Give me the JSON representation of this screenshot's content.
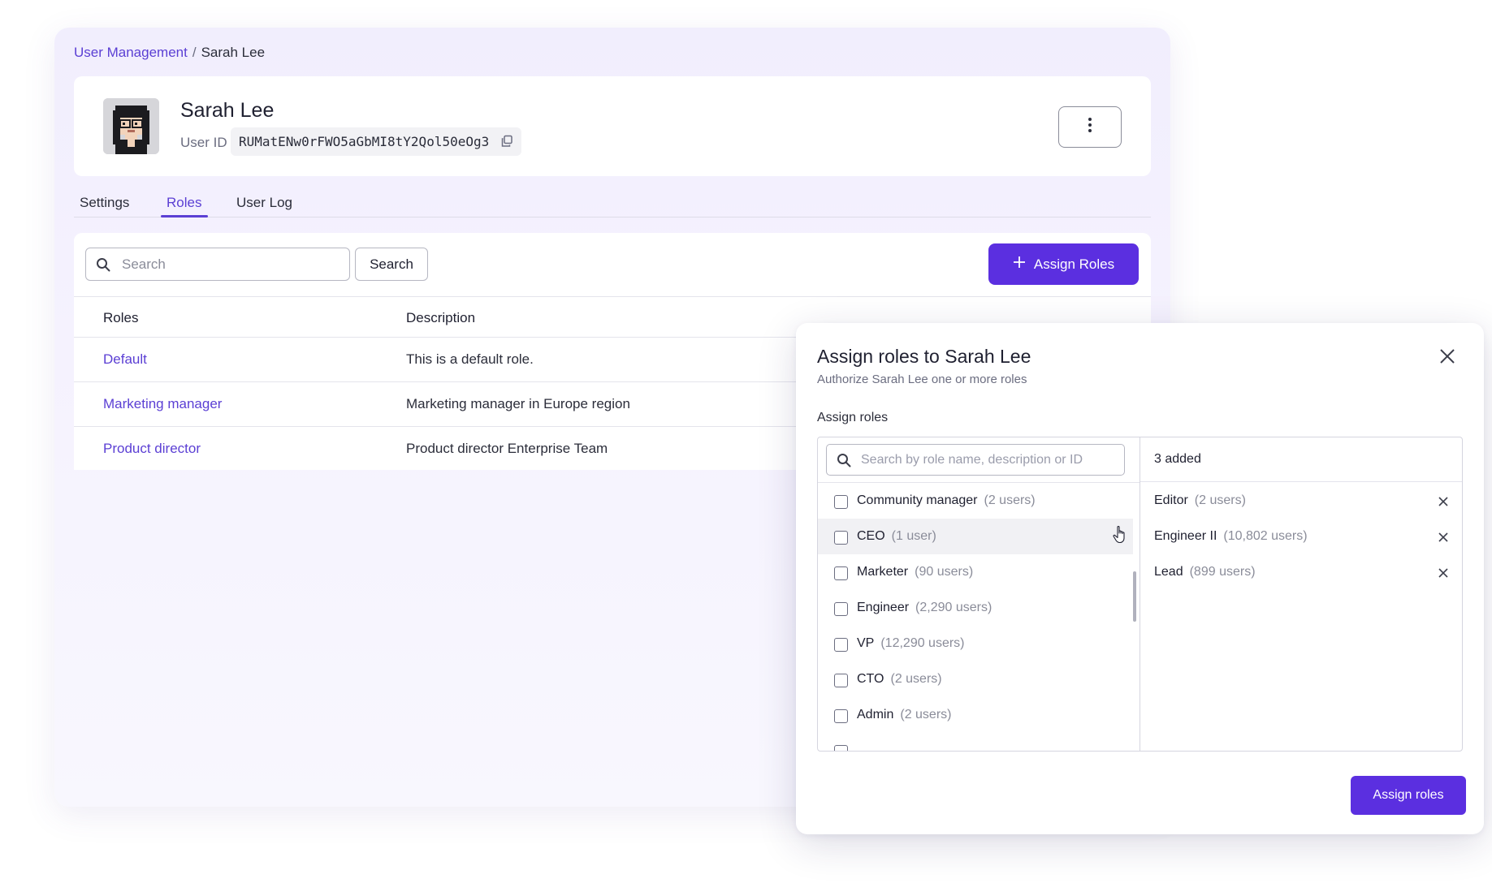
{
  "breadcrumb": {
    "parent": "User Management",
    "separator": "/",
    "current": "Sarah Lee"
  },
  "user": {
    "name": "Sarah Lee",
    "id_label": "User ID",
    "id_value": "RUMatENw0rFWO5aGbMI8tY2Qol50eOg3"
  },
  "tabs": [
    {
      "label": "Settings",
      "active": false
    },
    {
      "label": "Roles",
      "active": true
    },
    {
      "label": "User Log",
      "active": false
    }
  ],
  "roles_panel": {
    "search_placeholder": "Search",
    "search_button": "Search",
    "assign_button": "Assign Roles",
    "columns": [
      "Roles",
      "Description"
    ],
    "rows": [
      {
        "role": "Default",
        "description": "This is a default role."
      },
      {
        "role": "Marketing manager",
        "description": "Marketing manager in Europe region"
      },
      {
        "role": "Product director",
        "description": "Product director Enterprise Team"
      }
    ]
  },
  "modal": {
    "title": "Assign roles to Sarah Lee",
    "subtitle": "Authorize Sarah Lee one or more roles",
    "section_label": "Assign roles",
    "search_placeholder": "Search by role name, description or ID",
    "options": [
      {
        "name": "Community manager",
        "count": "(2 users)"
      },
      {
        "name": "CEO",
        "count": "(1 user)",
        "hovered": true
      },
      {
        "name": "Marketer",
        "count": "(90 users)"
      },
      {
        "name": "Engineer",
        "count": "(2,290 users)"
      },
      {
        "name": "VP",
        "count": "(12,290 users)"
      },
      {
        "name": "CTO",
        "count": "(2 users)"
      },
      {
        "name": "Admin",
        "count": "(2 users)"
      }
    ],
    "added_count": "3 added",
    "selected": [
      {
        "name": "Editor",
        "count": "(2 users)"
      },
      {
        "name": "Engineer II",
        "count": "(10,802 users)"
      },
      {
        "name": "Lead",
        "count": "(899 users)"
      }
    ],
    "confirm_button": "Assign roles"
  },
  "icons": {
    "search": "search-icon",
    "copy": "copy-icon",
    "more": "more-vertical-icon",
    "plus": "plus-icon",
    "close": "close-icon",
    "remove": "remove-icon",
    "cursor": "hand-pointer-icon"
  },
  "colors": {
    "accent": "#5b2fe0",
    "link": "#5b3fd4",
    "background_tint": "#f3f0fd"
  }
}
